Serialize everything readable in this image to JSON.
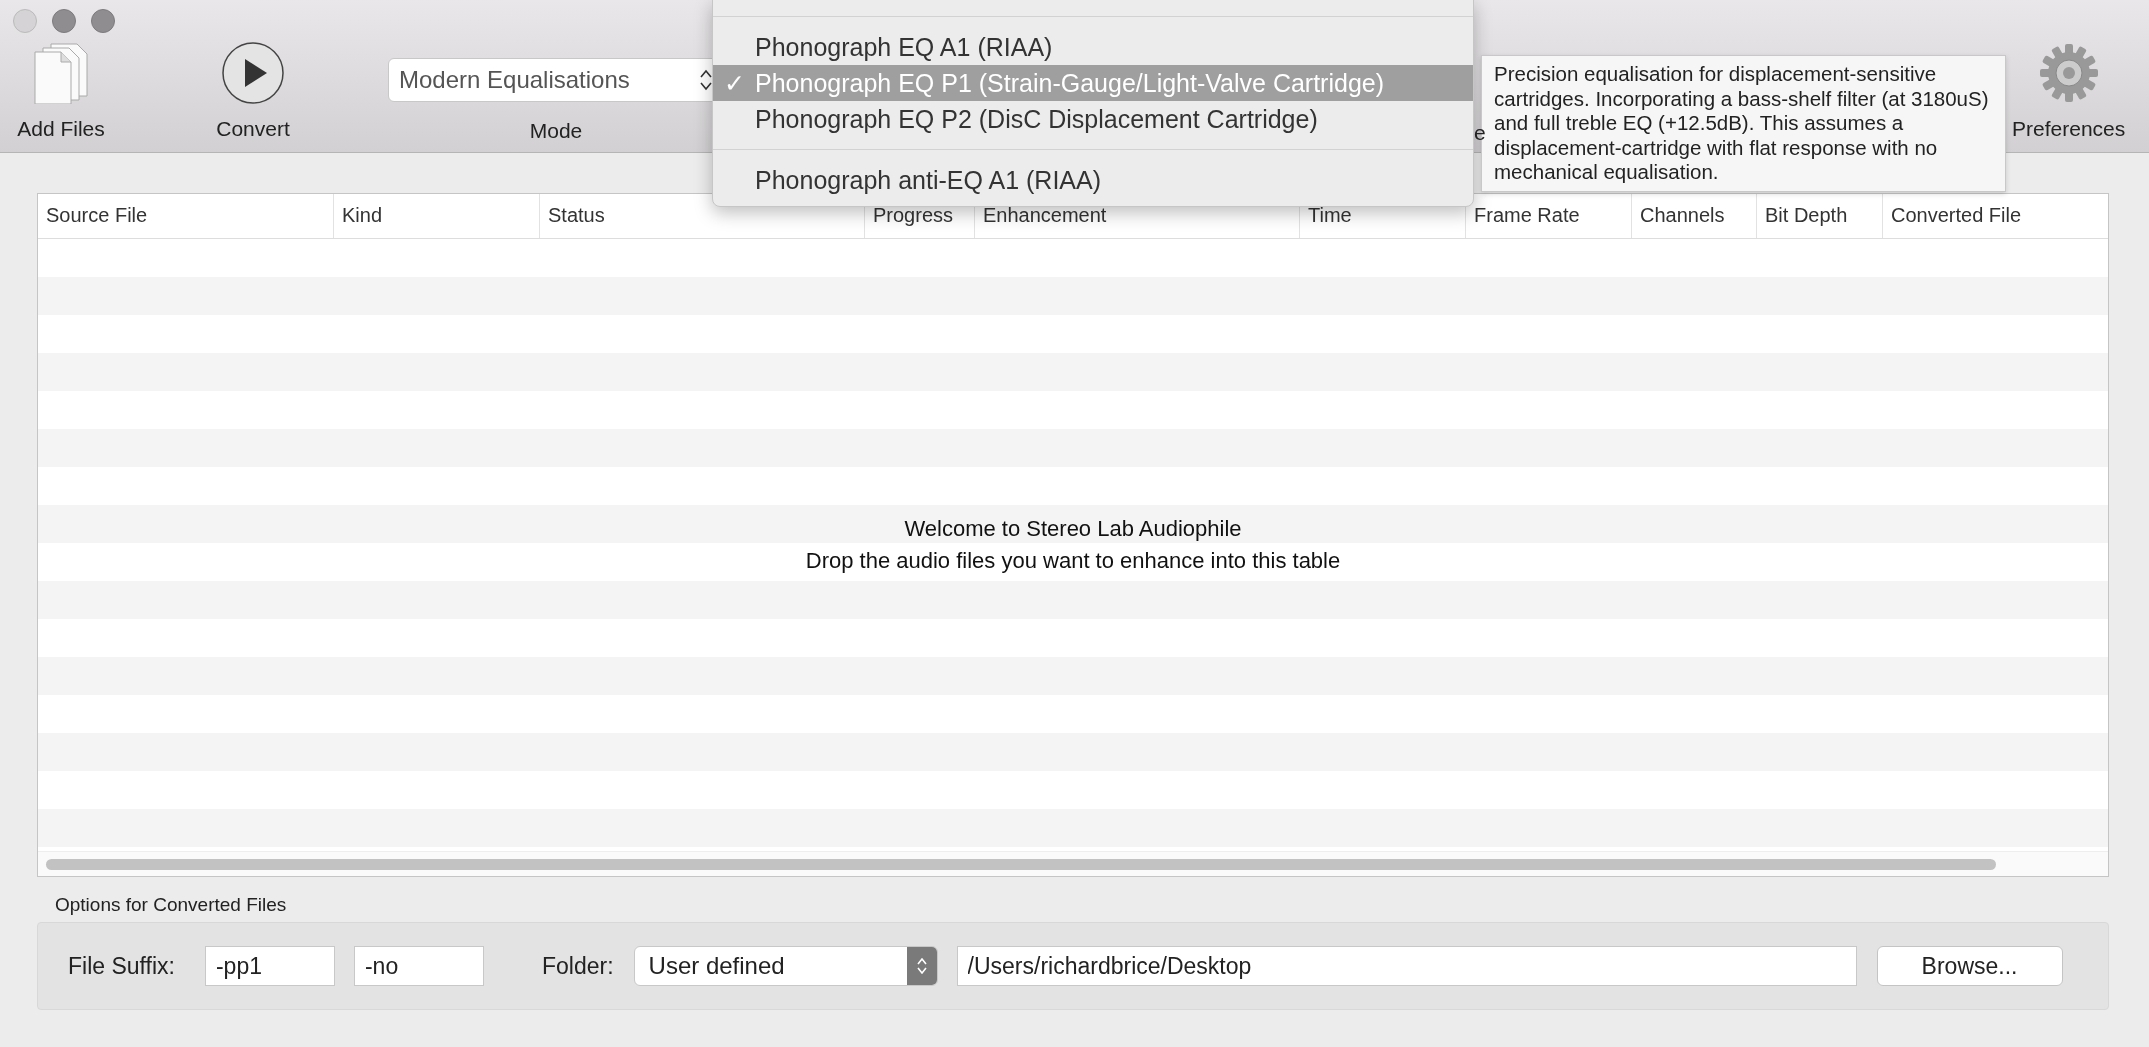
{
  "toolbar": [
    {
      "kind": "add_files",
      "label": "Add Files"
    },
    {
      "kind": "convert",
      "label": "Convert"
    },
    {
      "kind": "mode",
      "label": "Mode",
      "value": "Modern Equalisations"
    },
    {
      "kind": "partial",
      "label": "e"
    },
    {
      "kind": "preferences",
      "label": "Preferences"
    }
  ],
  "menu": [
    {
      "kind": "separator"
    },
    {
      "kind": "item",
      "label": "Phonograph EQ A1 (RIAA)",
      "selected": false,
      "checked": false
    },
    {
      "kind": "item",
      "label": "Phonograph EQ P1 (Strain-Gauge/Light-Valve Cartridge)",
      "selected": true,
      "checked": true
    },
    {
      "kind": "item",
      "label": "Phonograph EQ P2 (DisC Displacement Cartridge)",
      "selected": false,
      "checked": false
    },
    {
      "kind": "separator"
    },
    {
      "kind": "item",
      "label": "Phonograph anti-EQ A1 (RIAA)",
      "selected": false,
      "checked": false
    }
  ],
  "menu_check": "✓",
  "tooltip": "Precision equalisation for displacement-sensitive cartridges. Incorporating a bass-shelf filter (at 3180uS) and full treble EQ (+12.5dB). This assumes a displacement-cartridge with flat response with no mechanical equalisation.",
  "table": {
    "columns": [
      "Source File",
      "Kind",
      "Status",
      "Progress",
      "Enhancement",
      "Time",
      "Frame Rate",
      "Channels",
      "Bit Depth",
      "Converted File"
    ],
    "message": [
      "Welcome to Stereo Lab Audiophile",
      "Drop the audio files you want to enhance into this table"
    ]
  },
  "options": {
    "title": "Options for Converted Files",
    "suffix_label": "File Suffix:",
    "suffixes": [
      "-pp1",
      "-no"
    ],
    "folder_label": "Folder:",
    "folder": "User defined",
    "path": "/Users/richardbrice/Desktop",
    "browse": "Browse..."
  }
}
